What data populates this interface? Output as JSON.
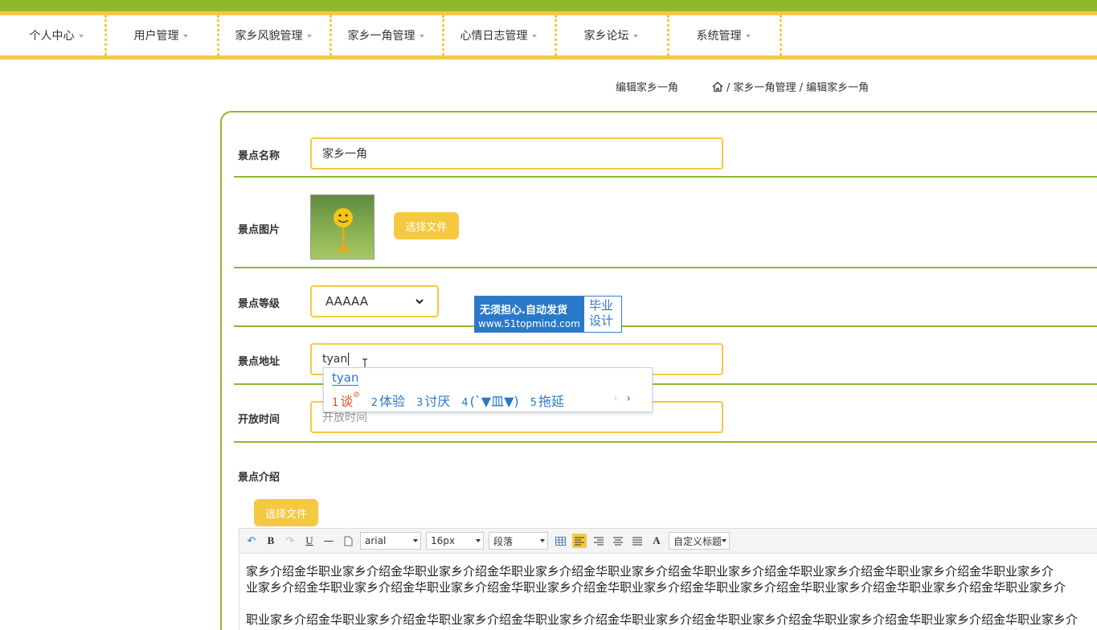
{
  "nav": {
    "items": [
      {
        "label": "个人中心"
      },
      {
        "label": "用户管理"
      },
      {
        "label": "家乡风貌管理"
      },
      {
        "label": "家乡一角管理"
      },
      {
        "label": "心情日志管理"
      },
      {
        "label": "家乡论坛"
      },
      {
        "label": "系统管理"
      }
    ]
  },
  "breadcrumb": {
    "page_title": "编辑家乡一角",
    "path": "/ 家乡一角管理 / 编辑家乡一角",
    "home_icon": "home-icon"
  },
  "form": {
    "name": {
      "label": "景点名称",
      "value": "家乡一角"
    },
    "image": {
      "label": "景点图片",
      "button": "选择文件"
    },
    "level": {
      "label": "景点等级",
      "value": "AAAAA"
    },
    "address": {
      "label": "景点地址",
      "value": "tyan"
    },
    "open_time": {
      "label": "开放时间",
      "placeholder": "开放时间"
    },
    "intro": {
      "label": "景点介绍",
      "button": "选择文件"
    }
  },
  "ad": {
    "line1": "无须担心.自动发货",
    "line2": "www.51topmind.com",
    "right1": "毕业",
    "right2": "设计"
  },
  "ime": {
    "code": "tyan",
    "candidates": [
      {
        "num": "1",
        "text": "谈"
      },
      {
        "num": "2",
        "text": "体验"
      },
      {
        "num": "3",
        "text": "讨厌"
      },
      {
        "num": "4",
        "text": "(ˋ▼皿▼)"
      },
      {
        "num": "5",
        "text": "拖延"
      }
    ]
  },
  "editor": {
    "toolbar": {
      "font": "arial",
      "size": "16px",
      "paragraph": "段落",
      "custom_title": "自定义标题"
    },
    "content_line1": "家乡介绍金华职业家乡介绍金华职业家乡介绍金华职业家乡介绍金华职业家乡介绍金华职业家乡介绍金华职业家乡介绍金华职业家乡介绍金华职业家乡介",
    "content_line2": "业家乡介绍金华职业家乡介绍金华职业家乡介绍金华职业家乡介绍金华职业家乡介绍金华职业家乡介绍金华职业家乡介绍金华职业家乡介绍金华职业家乡介",
    "content_line3": "职业家乡介绍金华职业家乡介绍金华职业家乡介绍金华职业家乡介绍金华职业家乡介绍金华职业家乡介绍金华职业家乡介绍金华职业家乡介绍金华职业家乡介"
  },
  "colors": {
    "green": "#8fb82a",
    "yellow": "#f5c842",
    "ad_blue": "#2a78c8"
  }
}
